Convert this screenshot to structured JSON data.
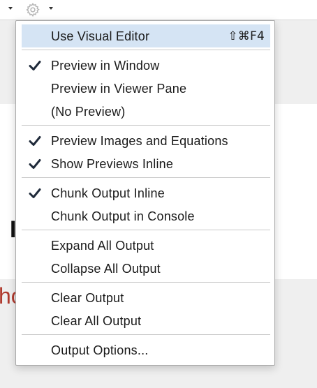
{
  "menu": {
    "items": [
      {
        "label": "Use Visual Editor",
        "shortcut": "⇧⌘F4",
        "checked": false,
        "highlighted": true
      },
      {
        "label": "Preview in Window",
        "checked": true
      },
      {
        "label": "Preview in Viewer Pane",
        "checked": false
      },
      {
        "label": "(No Preview)",
        "checked": false
      },
      {
        "label": "Preview Images and Equations",
        "checked": true
      },
      {
        "label": "Show Previews Inline",
        "checked": true
      },
      {
        "label": "Chunk Output Inline",
        "checked": true
      },
      {
        "label": "Chunk Output in Console",
        "checked": false
      },
      {
        "label": "Expand All Output",
        "checked": false
      },
      {
        "label": "Collapse All Output",
        "checked": false
      },
      {
        "label": "Clear Output",
        "checked": false
      },
      {
        "label": "Clear All Output",
        "checked": false
      },
      {
        "label": "Output Options...",
        "checked": false
      }
    ]
  },
  "colors": {
    "highlight": "#d5e4f4",
    "checkmark": "#1f2a3a",
    "background_red_text": "#b03a2e"
  },
  "icons": {
    "toolbar_gear": "gear-icon",
    "checkmark": "checkmark-icon"
  }
}
